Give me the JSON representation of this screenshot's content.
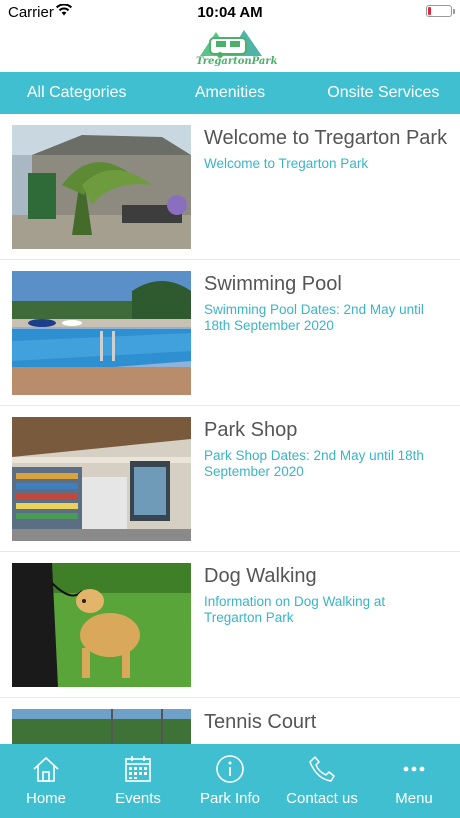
{
  "status": {
    "carrier": "Carrier",
    "time": "10:04 AM"
  },
  "brand": {
    "logo_text": "TregartonPark"
  },
  "categories": [
    {
      "label": "All Categories"
    },
    {
      "label": "Amenities"
    },
    {
      "label": "Onsite Services"
    }
  ],
  "items": [
    {
      "title": "Welcome to Tregarton Park",
      "description": "Welcome to Tregarton Park"
    },
    {
      "title": "Swimming Pool",
      "description": "Swimming Pool Dates: 2nd May until 18th September 2020"
    },
    {
      "title": "Park Shop",
      "description": "Park Shop Dates: 2nd May until 18th September 2020"
    },
    {
      "title": "Dog Walking",
      "description": "Information on Dog Walking at Tregarton Park"
    },
    {
      "title": "Tennis Court",
      "description": ""
    }
  ],
  "nav": [
    {
      "label": "Home",
      "icon": "home-icon"
    },
    {
      "label": "Events",
      "icon": "calendar-icon"
    },
    {
      "label": "Park Info",
      "icon": "info-icon"
    },
    {
      "label": "Contact us",
      "icon": "phone-icon"
    },
    {
      "label": "Menu",
      "icon": "more-icon"
    }
  ],
  "colors": {
    "accent": "#3fbfd0",
    "link": "#3ab4c8",
    "logo_green": "#4caf6a"
  }
}
